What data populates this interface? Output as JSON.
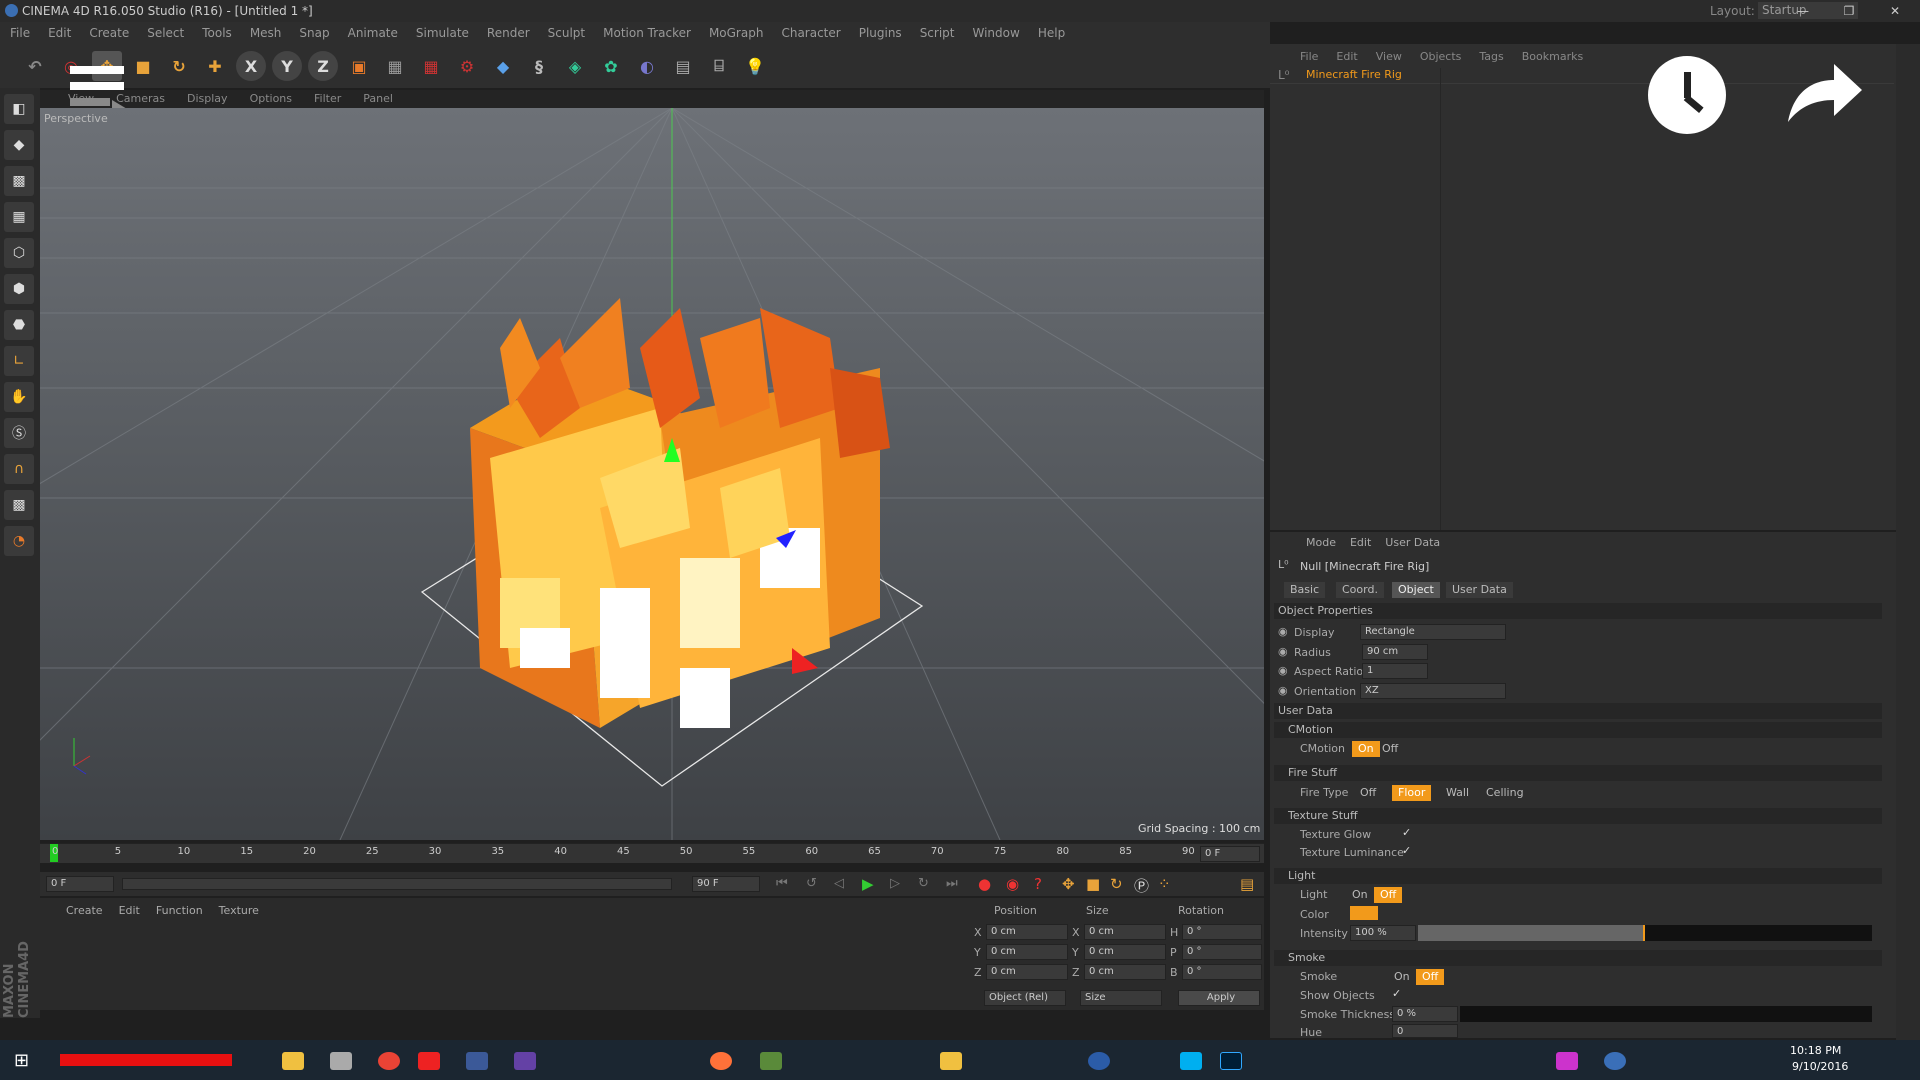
{
  "window": {
    "title": "CINEMA 4D R16.050 Studio (R16) - [Untitled 1 *]",
    "layout_label": "Layout:",
    "layout_value": "Startup"
  },
  "menu": [
    "File",
    "Edit",
    "Create",
    "Select",
    "Tools",
    "Mesh",
    "Snap",
    "Animate",
    "Simulate",
    "Render",
    "Sculpt",
    "Motion Tracker",
    "MoGraph",
    "Character",
    "Plugins",
    "Script",
    "Window",
    "Help"
  ],
  "viewport": {
    "menu": [
      "View",
      "Cameras",
      "Display",
      "Options",
      "Filter",
      "Panel"
    ],
    "label": "Perspective",
    "grid_spacing": "Grid Spacing : 100 cm"
  },
  "timeline": {
    "ticks": [
      "0",
      "5",
      "10",
      "15",
      "20",
      "25",
      "30",
      "35",
      "40",
      "45",
      "50",
      "55",
      "60",
      "65",
      "70",
      "75",
      "80",
      "85",
      "90"
    ],
    "current": "0 F",
    "start": "0 F",
    "end": "90 F",
    "end2": "90 F"
  },
  "material": {
    "menu": [
      "Create",
      "Edit",
      "Function",
      "Texture"
    ]
  },
  "coords": {
    "headers": [
      "Position",
      "Size",
      "Rotation"
    ],
    "rows": [
      {
        "a": "X",
        "av": "0 cm",
        "b": "X",
        "bv": "0 cm",
        "c": "H",
        "cv": "0 °"
      },
      {
        "a": "Y",
        "av": "0 cm",
        "b": "Y",
        "bv": "0 cm",
        "c": "P",
        "cv": "0 °"
      },
      {
        "a": "Z",
        "av": "0 cm",
        "b": "Z",
        "bv": "0 cm",
        "c": "B",
        "cv": "0 °"
      }
    ],
    "mode": "Object (Rel)",
    "size_mode": "Size",
    "apply": "Apply"
  },
  "objects": {
    "menu": [
      "File",
      "Edit",
      "View",
      "Objects",
      "Tags",
      "Bookmarks"
    ],
    "item": "Minecraft Fire Rig"
  },
  "attributes": {
    "menu": [
      "Mode",
      "Edit",
      "User Data"
    ],
    "object": "Null [Minecraft Fire Rig]",
    "tabs": [
      "Basic",
      "Coord.",
      "Object",
      "User Data"
    ],
    "object_props": "Object Properties",
    "display_lbl": "Display",
    "display_val": "Rectangle",
    "radius_lbl": "Radius",
    "radius_val": "90 cm",
    "aspect_lbl": "Aspect Ratio",
    "aspect_val": "1",
    "orient_lbl": "Orientation",
    "orient_val": "XZ",
    "user_data": "User Data",
    "cmotion_grp": "CMotion",
    "cmotion_lbl": "CMotion",
    "on": "On",
    "off": "Off",
    "fire_grp": "Fire Stuff",
    "firetype_lbl": "Fire Type",
    "fire_opts": [
      "Off",
      "Floor",
      "Wall",
      "Celling"
    ],
    "texture_grp": "Texture Stuff",
    "tex_glow": "Texture Glow",
    "tex_lum": "Texture Luminance",
    "light_grp": "Light",
    "light_lbl": "Light",
    "color_lbl": "Color",
    "intensity_lbl": "Intensity",
    "intensity_val": "100 %",
    "intensity_fill": 0.5,
    "smoke_grp": "Smoke",
    "smoke_lbl": "Smoke",
    "show_objects": "Show Objects",
    "smoke_thick": "Smoke Thickness",
    "smoke_thick_val": "0 %",
    "hue": "Hue",
    "hue_val": "0"
  },
  "taskbar": {
    "time": "10:18 PM",
    "date": "9/10/2016"
  },
  "colors": {
    "accent": "#f29a1b",
    "fire_light": "#ffe27a",
    "fire_mid": "#f39a1d",
    "fire_dark": "#d0491a"
  }
}
